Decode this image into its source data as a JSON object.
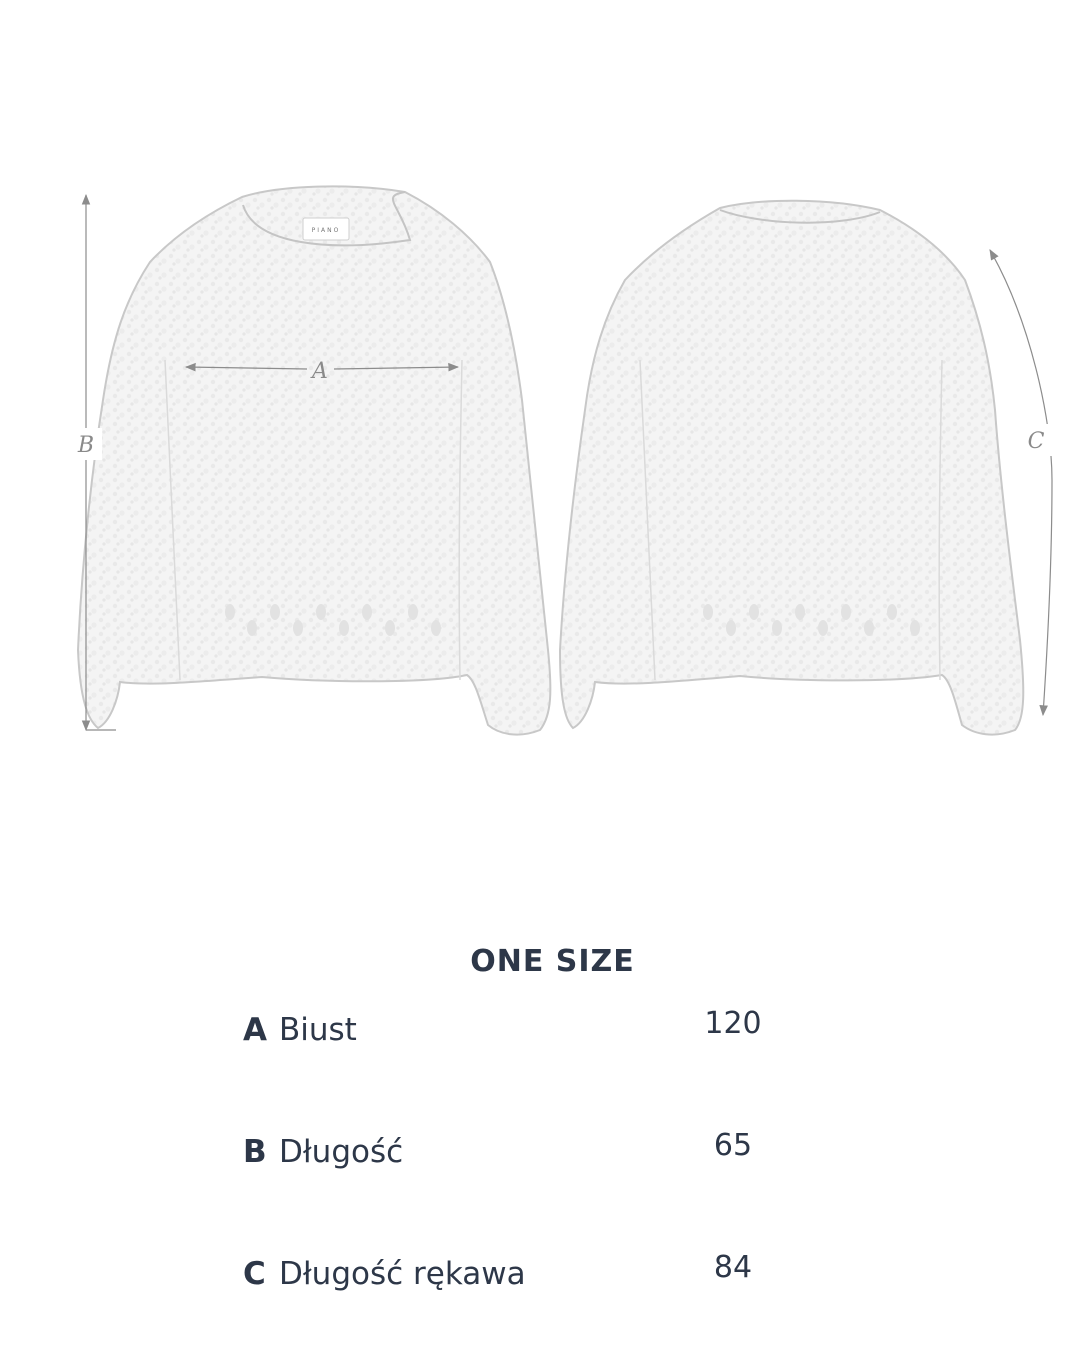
{
  "illustration": {
    "brand_label": "PIANO",
    "dimension_labels": {
      "a": "A",
      "b": "B",
      "c": "C"
    },
    "stroke_color": "#8c8c8c",
    "fill_color": "#f3f3f3"
  },
  "size_table": {
    "title": "ONE SIZE",
    "rows": [
      {
        "letter": "A",
        "name": "Biust",
        "value": "120"
      },
      {
        "letter": "B",
        "name": "Długość",
        "value": "65"
      },
      {
        "letter": "C",
        "name": "Długość rękawa",
        "value": "84"
      }
    ],
    "text_color": "#2d3748"
  }
}
